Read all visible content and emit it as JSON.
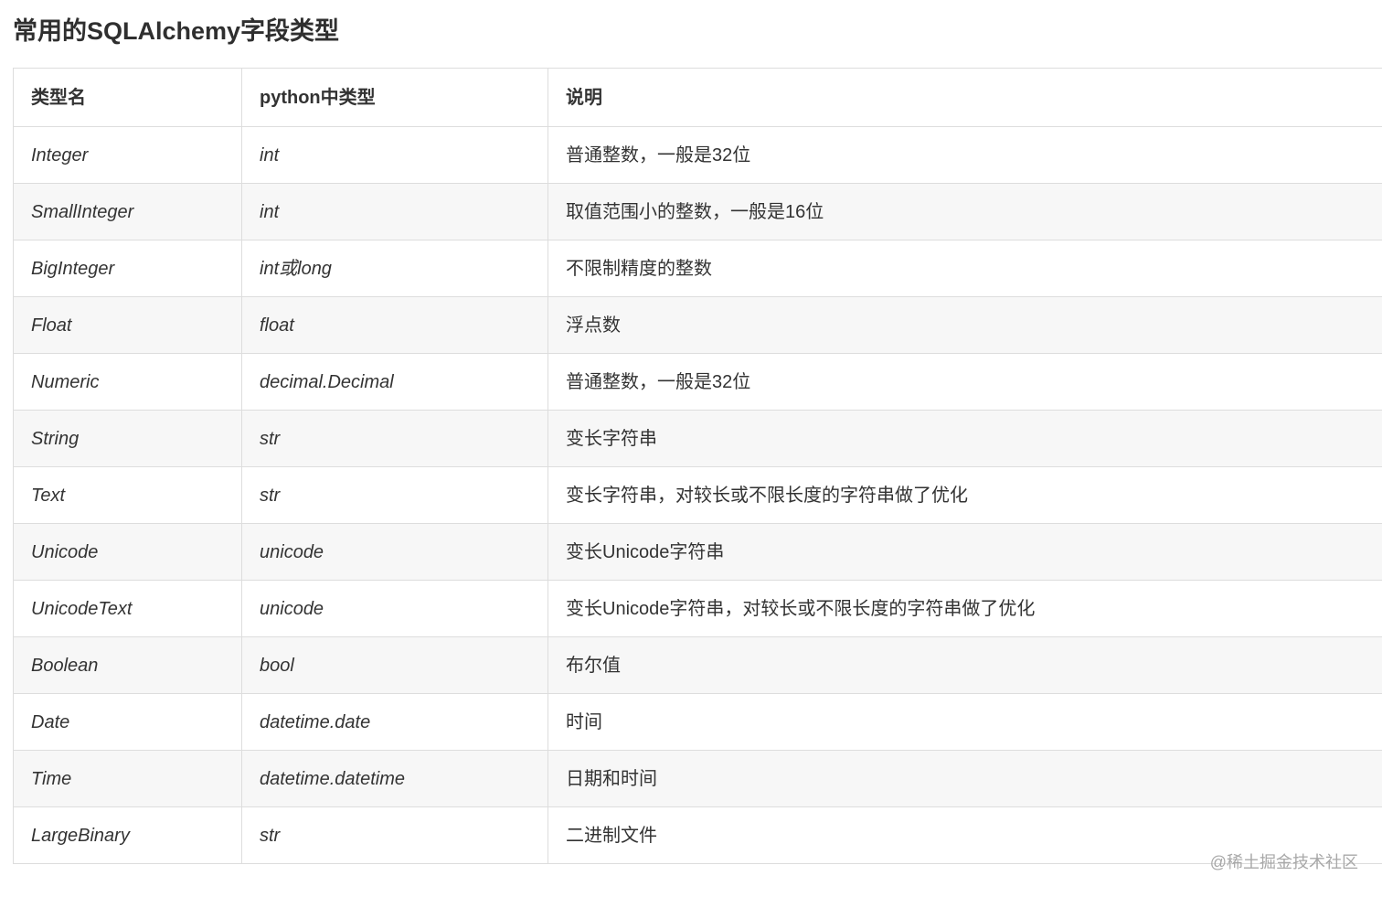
{
  "title": "常用的SQLAlchemy字段类型",
  "table": {
    "headers": [
      "类型名",
      "python中类型",
      "说明"
    ],
    "rows": [
      {
        "type": "Integer",
        "python": "int",
        "desc": "普通整数，一般是32位"
      },
      {
        "type": "SmallInteger",
        "python": "int",
        "desc": "取值范围小的整数，一般是16位"
      },
      {
        "type": "BigInteger",
        "python": "int或long",
        "desc": "不限制精度的整数"
      },
      {
        "type": "Float",
        "python": "float",
        "desc": "浮点数"
      },
      {
        "type": "Numeric",
        "python": "decimal.Decimal",
        "desc": "普通整数，一般是32位"
      },
      {
        "type": "String",
        "python": "str",
        "desc": "变长字符串"
      },
      {
        "type": "Text",
        "python": "str",
        "desc": "变长字符串，对较长或不限长度的字符串做了优化"
      },
      {
        "type": "Unicode",
        "python": "unicode",
        "desc": "变长Unicode字符串"
      },
      {
        "type": "UnicodeText",
        "python": "unicode",
        "desc": "变长Unicode字符串，对较长或不限长度的字符串做了优化"
      },
      {
        "type": "Boolean",
        "python": "bool",
        "desc": "布尔值"
      },
      {
        "type": "Date",
        "python": "datetime.date",
        "desc": "时间"
      },
      {
        "type": "Time",
        "python": "datetime.datetime",
        "desc": "日期和时间"
      },
      {
        "type": "LargeBinary",
        "python": "str",
        "desc": "二进制文件"
      }
    ]
  },
  "watermark": "@稀土掘金技术社区"
}
